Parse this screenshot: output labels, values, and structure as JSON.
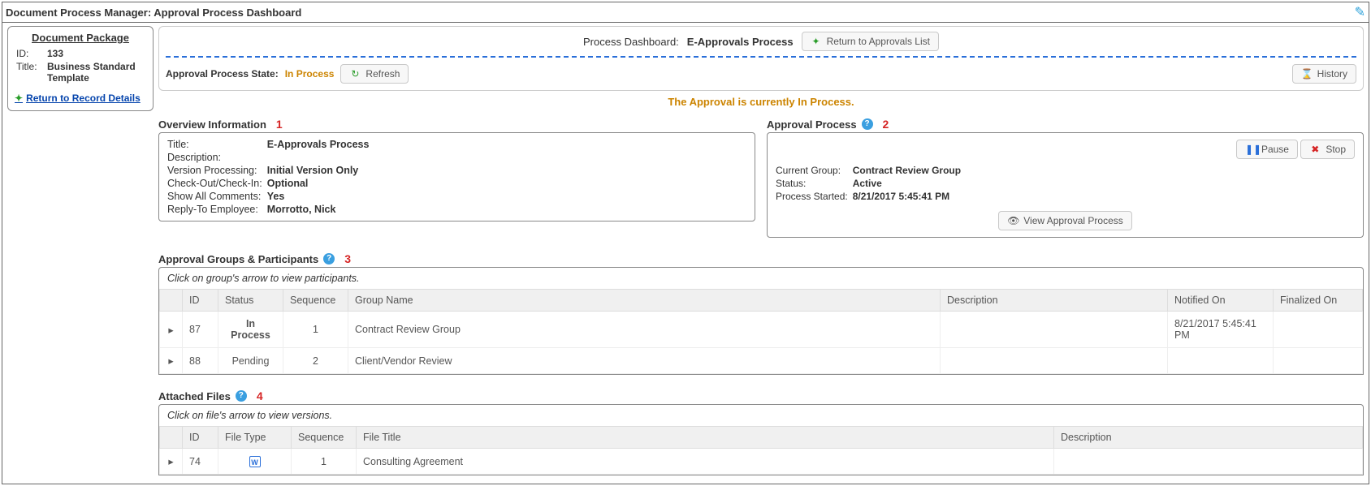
{
  "titlebar": "Document Process Manager: Approval Process Dashboard",
  "left": {
    "heading": "Document Package",
    "id_label": "ID:",
    "id": "133",
    "title_label": "Title:",
    "title": "Business Standard Template",
    "return_link": "Return to Record Details"
  },
  "dash": {
    "label": "Process Dashboard:",
    "name": "E-Approvals Process",
    "return_btn": "Return to Approvals List",
    "state_label": "Approval Process State:",
    "state": "In Process",
    "refresh_btn": "Refresh",
    "history_btn": "History",
    "status_msg": "The Approval is currently In Process."
  },
  "overview": {
    "heading": "Overview Information",
    "callout": "1",
    "title_k": "Title:",
    "title_v": "E-Approvals Process",
    "desc_k": "Description:",
    "desc_v": "",
    "ver_k": "Version Processing:",
    "ver_v": "Initial Version Only",
    "cio_k": "Check-Out/Check-In:",
    "cio_v": "Optional",
    "show_k": "Show All Comments:",
    "show_v": "Yes",
    "reply_k": "Reply-To Employee:",
    "reply_v": "Morrotto, Nick"
  },
  "approval": {
    "heading": "Approval Process",
    "callout": "2",
    "pause_btn": "Pause",
    "stop_btn": "Stop",
    "cg_k": "Current Group:",
    "cg_v": "Contract Review Group",
    "st_k": "Status:",
    "st_v": "Active",
    "ps_k": "Process Started:",
    "ps_v": "8/21/2017 5:45:41 PM",
    "view_btn": "View Approval Process"
  },
  "groups": {
    "heading": "Approval Groups & Participants",
    "callout": "3",
    "note": "Click on group's arrow to view participants.",
    "cols": {
      "id": "ID",
      "status": "Status",
      "seq": "Sequence",
      "name": "Group Name",
      "desc": "Description",
      "notified": "Notified On",
      "finalized": "Finalized On"
    },
    "rows": [
      {
        "id": "87",
        "status": "In Process",
        "status_class": "status-inprocess",
        "seq": "1",
        "name": "Contract Review Group",
        "desc": "",
        "notified": "8/21/2017 5:45:41 PM",
        "finalized": ""
      },
      {
        "id": "88",
        "status": "Pending",
        "status_class": "status-pending",
        "seq": "2",
        "name": "Client/Vendor Review",
        "desc": "",
        "notified": "",
        "finalized": ""
      }
    ]
  },
  "files": {
    "heading": "Attached Files",
    "callout": "4",
    "note": "Click on file's arrow to view versions.",
    "cols": {
      "id": "ID",
      "ftype": "File Type",
      "seq": "Sequence",
      "title": "File Title",
      "desc": "Description"
    },
    "rows": [
      {
        "id": "74",
        "seq": "1",
        "title": "Consulting Agreement",
        "desc": ""
      }
    ]
  }
}
